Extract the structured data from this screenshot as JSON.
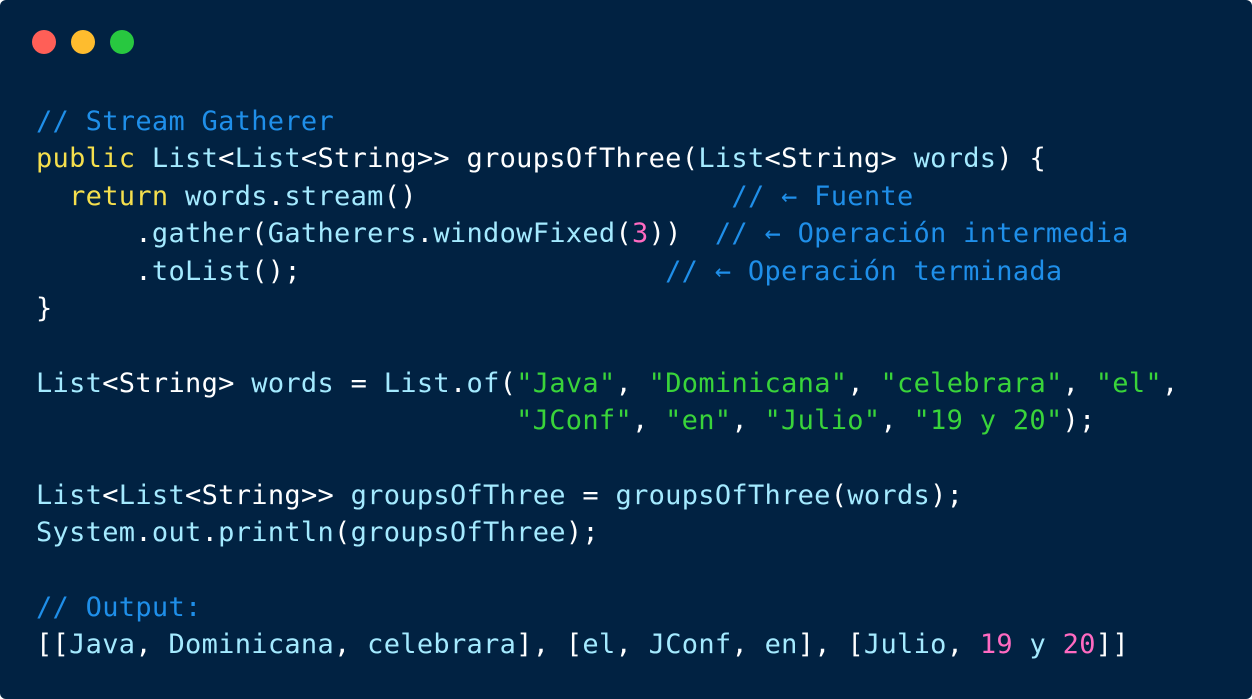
{
  "window": {
    "background": "#012242",
    "controls": [
      {
        "name": "close",
        "color": "#ff5f57"
      },
      {
        "name": "minimize",
        "color": "#febc2e"
      },
      {
        "name": "maximize",
        "color": "#28c840"
      }
    ]
  },
  "colors": {
    "comment": "#1f8fe9",
    "keyword": "#f5df4d",
    "type": "#a4eaff",
    "ident": "#a4eaff",
    "punct": "#ffffff",
    "string": "#39d43a",
    "number": "#ff6ac1"
  },
  "code": {
    "lines": [
      [
        [
          "comment",
          "// Stream Gatherer"
        ]
      ],
      [
        [
          "keyword",
          "public"
        ],
        [
          "punct",
          " "
        ],
        [
          "type",
          "List"
        ],
        [
          "punct",
          "<"
        ],
        [
          "type",
          "List"
        ],
        [
          "punct",
          "<"
        ],
        [
          "punct",
          "String"
        ],
        [
          "punct",
          ">> "
        ],
        [
          "punct",
          "groupsOfThree"
        ],
        [
          "punct",
          "("
        ],
        [
          "type",
          "List"
        ],
        [
          "punct",
          "<"
        ],
        [
          "punct",
          "String"
        ],
        [
          "punct",
          "> "
        ],
        [
          "ident",
          "words"
        ],
        [
          "punct",
          ") {"
        ]
      ],
      [
        [
          "punct",
          "  "
        ],
        [
          "keyword",
          "return"
        ],
        [
          "punct",
          " "
        ],
        [
          "ident",
          "words"
        ],
        [
          "punct",
          "."
        ],
        [
          "ident",
          "stream"
        ],
        [
          "punct",
          "()                   "
        ],
        [
          "comment",
          "// ← Fuente"
        ]
      ],
      [
        [
          "punct",
          "      ."
        ],
        [
          "ident",
          "gather"
        ],
        [
          "punct",
          "("
        ],
        [
          "ident",
          "Gatherers"
        ],
        [
          "punct",
          "."
        ],
        [
          "ident",
          "windowFixed"
        ],
        [
          "punct",
          "("
        ],
        [
          "number",
          "3"
        ],
        [
          "punct",
          "))  "
        ],
        [
          "comment",
          "// ← Operación intermedia"
        ]
      ],
      [
        [
          "punct",
          "      ."
        ],
        [
          "ident",
          "toList"
        ],
        [
          "punct",
          "();                      "
        ],
        [
          "comment",
          "// ← Operación terminada"
        ]
      ],
      [
        [
          "punct",
          "}"
        ]
      ],
      [],
      [
        [
          "type",
          "List"
        ],
        [
          "punct",
          "<"
        ],
        [
          "punct",
          "String"
        ],
        [
          "punct",
          "> "
        ],
        [
          "ident",
          "words"
        ],
        [
          "punct",
          " = "
        ],
        [
          "type",
          "List"
        ],
        [
          "punct",
          "."
        ],
        [
          "ident",
          "of"
        ],
        [
          "punct",
          "("
        ],
        [
          "string",
          "\"Java\""
        ],
        [
          "punct",
          ", "
        ],
        [
          "string",
          "\"Dominicana\""
        ],
        [
          "punct",
          ", "
        ],
        [
          "string",
          "\"celebrara\""
        ],
        [
          "punct",
          ", "
        ],
        [
          "string",
          "\"el\""
        ],
        [
          "punct",
          ","
        ]
      ],
      [
        [
          "punct",
          "                             "
        ],
        [
          "string",
          "\"JConf\""
        ],
        [
          "punct",
          ", "
        ],
        [
          "string",
          "\"en\""
        ],
        [
          "punct",
          ", "
        ],
        [
          "string",
          "\"Julio\""
        ],
        [
          "punct",
          ", "
        ],
        [
          "string",
          "\"19 y 20\""
        ],
        [
          "punct",
          ");"
        ]
      ],
      [],
      [
        [
          "type",
          "List"
        ],
        [
          "punct",
          "<"
        ],
        [
          "type",
          "List"
        ],
        [
          "punct",
          "<"
        ],
        [
          "punct",
          "String"
        ],
        [
          "punct",
          ">> "
        ],
        [
          "ident",
          "groupsOfThree"
        ],
        [
          "punct",
          " = "
        ],
        [
          "ident",
          "groupsOfThree"
        ],
        [
          "punct",
          "("
        ],
        [
          "ident",
          "words"
        ],
        [
          "punct",
          ");"
        ]
      ],
      [
        [
          "ident",
          "System"
        ],
        [
          "punct",
          "."
        ],
        [
          "ident",
          "out"
        ],
        [
          "punct",
          "."
        ],
        [
          "ident",
          "println"
        ],
        [
          "punct",
          "("
        ],
        [
          "ident",
          "groupsOfThree"
        ],
        [
          "punct",
          ");"
        ]
      ],
      [],
      [
        [
          "comment",
          "// Output:"
        ]
      ],
      [
        [
          "punct",
          "[["
        ],
        [
          "ident",
          "Java"
        ],
        [
          "punct",
          ", "
        ],
        [
          "ident",
          "Dominicana"
        ],
        [
          "punct",
          ", "
        ],
        [
          "ident",
          "celebrara"
        ],
        [
          "punct",
          "], ["
        ],
        [
          "ident",
          "el"
        ],
        [
          "punct",
          ", "
        ],
        [
          "ident",
          "JConf"
        ],
        [
          "punct",
          ", "
        ],
        [
          "ident",
          "en"
        ],
        [
          "punct",
          "], ["
        ],
        [
          "ident",
          "Julio"
        ],
        [
          "punct",
          ", "
        ],
        [
          "number",
          "19"
        ],
        [
          "punct",
          " "
        ],
        [
          "ident",
          "y"
        ],
        [
          "punct",
          " "
        ],
        [
          "number",
          "20"
        ],
        [
          "punct",
          "]]"
        ]
      ]
    ]
  }
}
